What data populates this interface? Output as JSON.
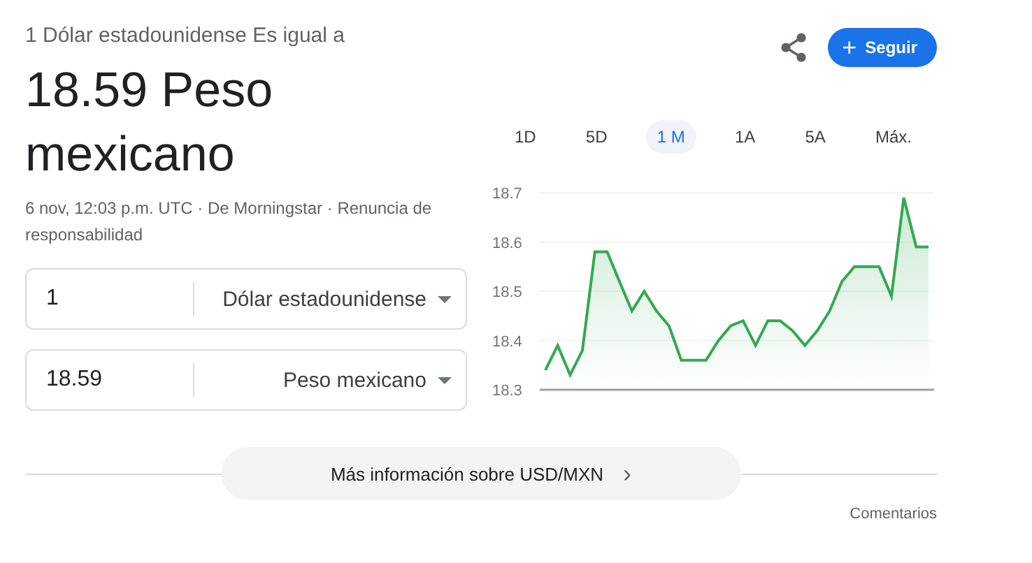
{
  "header": {
    "subtitle": "1 Dólar estadounidense Es igual a",
    "result": "18.59 Peso mexicano",
    "meta": "6 nov, 12:03 p.m. UTC · De Morningstar · Renuncia de responsabilidad"
  },
  "follow_button": {
    "icon": "+",
    "label": "Seguir"
  },
  "converter": [
    {
      "amount": "1",
      "currency": "Dólar estadounidense"
    },
    {
      "amount": "18.59",
      "currency": "Peso mexicano"
    }
  ],
  "ranges": [
    {
      "label": "1D",
      "selected": false
    },
    {
      "label": "5D",
      "selected": false
    },
    {
      "label": "1 M",
      "selected": true
    },
    {
      "label": "1A",
      "selected": false
    },
    {
      "label": "5A",
      "selected": false
    },
    {
      "label": "Máx.",
      "selected": false
    }
  ],
  "chart_data": {
    "type": "area",
    "grid": true,
    "ylim": [
      18.3,
      18.7
    ],
    "yticks": [
      18.3,
      18.4,
      18.5,
      18.6,
      18.7
    ],
    "series": [
      {
        "color": "#34a853",
        "values": [
          18.34,
          18.39,
          18.33,
          18.38,
          18.58,
          18.58,
          18.52,
          18.46,
          18.5,
          18.46,
          18.43,
          18.36,
          18.36,
          18.36,
          18.4,
          18.43,
          18.44,
          18.39,
          18.44,
          18.44,
          18.42,
          18.39,
          18.42,
          18.46,
          18.52,
          18.55,
          18.55,
          18.55,
          18.49,
          18.69,
          18.59,
          18.59
        ]
      }
    ]
  },
  "more_button": {
    "label": "Más información sobre USD/MXN",
    "icon": "›"
  },
  "feedback": "Comentarios"
}
